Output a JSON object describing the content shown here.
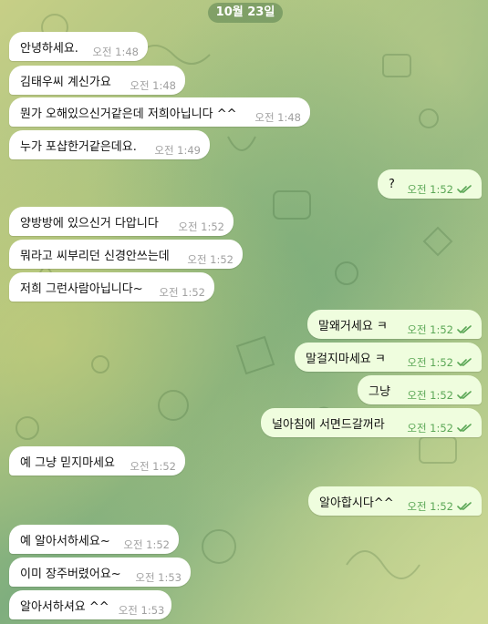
{
  "date_label": "10월 23일",
  "messages": [
    {
      "dir": "in",
      "text": "안녕하세요.",
      "time": "오전 1:48"
    },
    {
      "dir": "in",
      "text": "김태우씨 계신가요",
      "time": "오전 1:48"
    },
    {
      "dir": "in",
      "text": "뭔가 오해있으신거같은데 저희아닙니다 ^^",
      "time": "오전 1:48"
    },
    {
      "dir": "in",
      "text": "누가 포샵한거같은데요.",
      "time": "오전 1:49"
    },
    {
      "dir": "out",
      "text": "?",
      "time": "오전 1:52",
      "read": true
    },
    {
      "dir": "in",
      "text": "양방방에 있으신거 다압니다",
      "time": "오전 1:52"
    },
    {
      "dir": "in",
      "text": "뭐라고 씨부리던 신경안쓰는데",
      "time": "오전 1:52"
    },
    {
      "dir": "in",
      "text": "저희 그런사람아닙니다~",
      "time": "오전 1:52"
    },
    {
      "dir": "out",
      "text": "말왜거세요 ㅋ",
      "time": "오전 1:52",
      "read": true
    },
    {
      "dir": "out",
      "text": "말걸지마세요 ㅋ",
      "time": "오전 1:52",
      "read": true
    },
    {
      "dir": "out",
      "text": "그냥",
      "time": "오전 1:52",
      "read": true
    },
    {
      "dir": "out",
      "text": "널아침에 서면드갈꺼라",
      "time": "오전 1:52",
      "read": true
    },
    {
      "dir": "in",
      "text": "예 그냥 믿지마세요",
      "time": "오전 1:52"
    },
    {
      "dir": "out",
      "text": "알아합시다^^",
      "time": "오전 1:52",
      "read": true
    },
    {
      "dir": "in",
      "text": "예 알아서하세요~",
      "time": "오전 1:52"
    },
    {
      "dir": "in",
      "text": "이미 장주버렸어요~",
      "time": "오전 1:53"
    },
    {
      "dir": "in",
      "text": "알아서하셔요 ^^",
      "time": "오전 1:53"
    }
  ],
  "colors": {
    "incoming": "#ffffff",
    "outgoing": "#effdde",
    "time_outgoing": "#5ba756",
    "time_incoming": "#a0a0a0"
  }
}
